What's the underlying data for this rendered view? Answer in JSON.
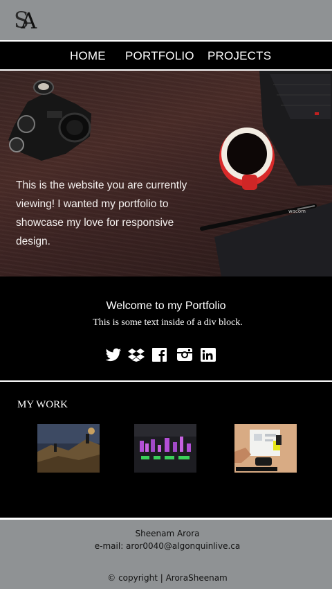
{
  "header": {
    "logo_text": "SA",
    "logo_letter_s": "S",
    "logo_letter_a": "A"
  },
  "nav": {
    "items": [
      {
        "label": "HOME"
      },
      {
        "label": "PORTFOLIO"
      },
      {
        "label": "PROJECTS"
      }
    ]
  },
  "hero": {
    "text": "This is the website you are currently viewing! I wanted my portfolio to showcase my love for responsive design.",
    "tablet_brand": "wacom"
  },
  "welcome": {
    "title": "Welcome to my Portfolio",
    "subtitle": "This is some text inside of a div block."
  },
  "social": {
    "icons": [
      "twitter-icon",
      "dropbox-icon",
      "facebook-icon",
      "instagram-icon",
      "linkedin-icon"
    ]
  },
  "work": {
    "title": "MY WORK",
    "thumbnails": [
      "landscape-thumbnail",
      "video-editing-thumbnail",
      "web-design-thumbnail"
    ]
  },
  "footer": {
    "name": "Sheenam Arora",
    "email": "e-mail: aror0040@algonquinlive.ca",
    "copyright": "© copyright | AroraSheenam"
  },
  "colors": {
    "header_bg": "#8f9294",
    "footer_bg": "#8f9294",
    "body_bg": "#000000",
    "text_light": "#ffffff"
  }
}
